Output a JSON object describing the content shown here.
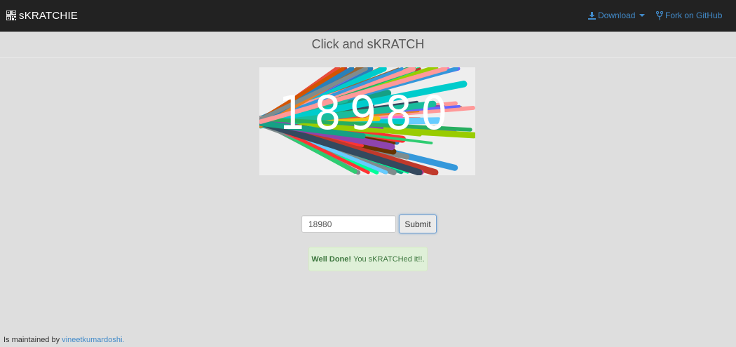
{
  "navbar": {
    "brand": "sKRATCHIE",
    "brand_icon": "qrcode-icon",
    "download_label": "Download",
    "download_icon": "download-icon",
    "fork_label": "Fork on GitHub",
    "fork_icon": "fork-icon",
    "link_color": "#428bca"
  },
  "main": {
    "title": "Click and sKRATCH",
    "captcha_text": "18980",
    "answer_value": "18980",
    "submit_label": "Submit"
  },
  "alert": {
    "strong": "Well Done!",
    "message": "You sKRATCHed it!!."
  },
  "footer": {
    "prefix": "Is maintained by",
    "author_link": "vineetkumardoshi."
  }
}
